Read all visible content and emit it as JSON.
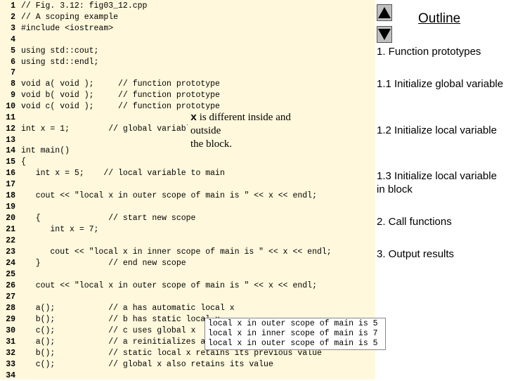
{
  "code_lines": [
    {
      "n": "1",
      "text": "// Fig. 3.12: fig03_12.cpp"
    },
    {
      "n": "2",
      "text": "// A scoping example"
    },
    {
      "n": "3",
      "text": "#include <iostream>"
    },
    {
      "n": "4",
      "text": ""
    },
    {
      "n": "5",
      "text": "using std::cout;"
    },
    {
      "n": "6",
      "text": "using std::endl;"
    },
    {
      "n": "7",
      "text": ""
    },
    {
      "n": "8",
      "text": "void a( void );     // function prototype"
    },
    {
      "n": "9",
      "text": "void b( void );     // function prototype"
    },
    {
      "n": "10",
      "text": "void c( void );     // function prototype"
    },
    {
      "n": "11",
      "text": ""
    },
    {
      "n": "12",
      "text": "int x = 1;        // global variable"
    },
    {
      "n": "13",
      "text": ""
    },
    {
      "n": "14",
      "text": "int main()"
    },
    {
      "n": "15",
      "text": "{"
    },
    {
      "n": "16",
      "text": "   int x = 5;    // local variable to main"
    },
    {
      "n": "17",
      "text": ""
    },
    {
      "n": "18",
      "text": "   cout << \"local x in outer scope of main is \" << x << endl;"
    },
    {
      "n": "19",
      "text": ""
    },
    {
      "n": "20",
      "text": "   {              // start new scope"
    },
    {
      "n": "21",
      "text": "      int x = 7;"
    },
    {
      "n": "22",
      "text": ""
    },
    {
      "n": "23",
      "text": "      cout << \"local x in inner scope of main is \" << x << endl;"
    },
    {
      "n": "24",
      "text": "   }              // end new scope"
    },
    {
      "n": "25",
      "text": ""
    },
    {
      "n": "26",
      "text": "   cout << \"local x in outer scope of main is \" << x << endl;"
    },
    {
      "n": "27",
      "text": ""
    },
    {
      "n": "28",
      "text": "   a();           // a has automatic local x"
    },
    {
      "n": "29",
      "text": "   b();           // b has static local x"
    },
    {
      "n": "30",
      "text": "   c();           // c uses global x"
    },
    {
      "n": "31",
      "text": "   a();           // a reinitializes automatic local x"
    },
    {
      "n": "32",
      "text": "   b();           // static local x retains its previous value"
    },
    {
      "n": "33",
      "text": "   c();           // global x also retains its value"
    },
    {
      "n": "34",
      "text": ""
    }
  ],
  "callout": {
    "var": "x",
    "text_line1": " is different inside and outside",
    "text_line2": "the block."
  },
  "output_lines": [
    "local x in outer scope of main is 5",
    "local x in inner scope of main is 7",
    "local x in outer scope of main is 5"
  ],
  "outline": {
    "title": "Outline",
    "items": [
      "1. Function prototypes",
      "1.1  Initialize global variable",
      "1.2  Initialize local variable",
      "1.3  Initialize local variable in block",
      "2.  Call functions",
      "3.  Output results"
    ]
  },
  "nav": {
    "up_icon": "triangle-up-icon",
    "down_icon": "triangle-down-icon"
  },
  "colors": {
    "code_background": "#fff8dc",
    "nav_button": "#bfbfbf"
  }
}
